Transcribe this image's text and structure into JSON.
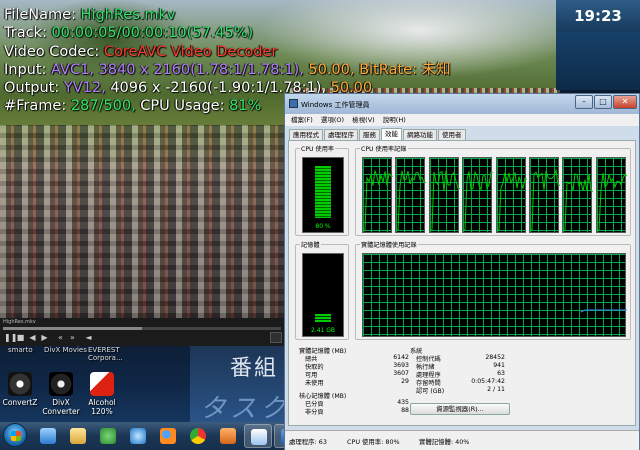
{
  "osd": {
    "file_label": "FileName:",
    "file_value": "HighRes.mkv",
    "track_label": "Track:",
    "track_value": "00:00:05/00:00:10",
    "track_pct": "(57.45%)",
    "codec_label": "Video Codec:",
    "codec_value": "CoreAVC Video Decoder",
    "input_label": "Input:",
    "input_codec": "AVC1,",
    "input_res": "3840 x 2160(1.78:1/1.78:1),",
    "input_fps": "50.00,",
    "input_br_label": "BitRate:",
    "input_br_value": "未知",
    "output_label": "Output:",
    "output_fmt": "YV12,",
    "output_res": "4096 x -2160(-1.90:1/1.78:1),",
    "output_fps": "50.00",
    "frame_label": "#Frame:",
    "frame_value": "287/500,",
    "cpu_label": "CPU Usage:",
    "cpu_value": "81%"
  },
  "clock": {
    "time": "19:23"
  },
  "player": {
    "title": "HighRes.mkv",
    "progress": 0.5
  },
  "desktop": {
    "top_labels": [
      "smarto",
      "DivX Movies",
      "EVEREST Corpora..."
    ],
    "icons": [
      {
        "label": "ConvertZ"
      },
      {
        "label": "DivX Converter"
      },
      {
        "label": "Alcohol 120%"
      }
    ],
    "banner_text": "番組",
    "banner_text2": "タスク"
  },
  "taskmanager": {
    "title": "Windows 工作管理員",
    "menus": [
      "檔案(F)",
      "選項(O)",
      "檢視(V)",
      "說明(H)"
    ],
    "tabs": [
      "應用程式",
      "處理程序",
      "服務",
      "效能",
      "網路功能",
      "使用者"
    ],
    "active_tab": "效能",
    "groups": {
      "cpu": "CPU 使用率",
      "cpu_hist": "CPU 使用率記錄",
      "mem": "記憶體",
      "mem_hist": "實體記憶體使用記錄"
    },
    "cpu_value": "80 %",
    "mem_value": "2.41 GB",
    "physical_mem": {
      "header": "實體記憶體 (MB)",
      "rows": [
        [
          "總共",
          "6142"
        ],
        [
          "快取的",
          "3693"
        ],
        [
          "可用",
          "3607"
        ],
        [
          "未使用",
          "29"
        ]
      ]
    },
    "kernel_mem": {
      "header": "核心記憶體 (MB)",
      "rows": [
        [
          "已分頁",
          "435"
        ],
        [
          "非分頁",
          "88"
        ]
      ]
    },
    "system": {
      "header": "系統",
      "rows": [
        [
          "控制代碼",
          "28452"
        ],
        [
          "執行緒",
          "941"
        ],
        [
          "處理程序",
          "63"
        ],
        [
          "存留時間",
          "0:05:47:42"
        ],
        [
          "認可 (GB)",
          "2 / 11"
        ]
      ]
    },
    "res_button": "資源監視器(R)...",
    "status": {
      "processes": "處理程序: 63",
      "cpu": "CPU 使用率: 80%",
      "mem": "實體記憶體: 40%"
    }
  },
  "colors": {
    "osd_green": "#33e36a",
    "osd_red": "#ff3b2f",
    "osd_purple": "#b47cff",
    "osd_orange": "#ffa83a",
    "graph_green": "#00cc00"
  }
}
